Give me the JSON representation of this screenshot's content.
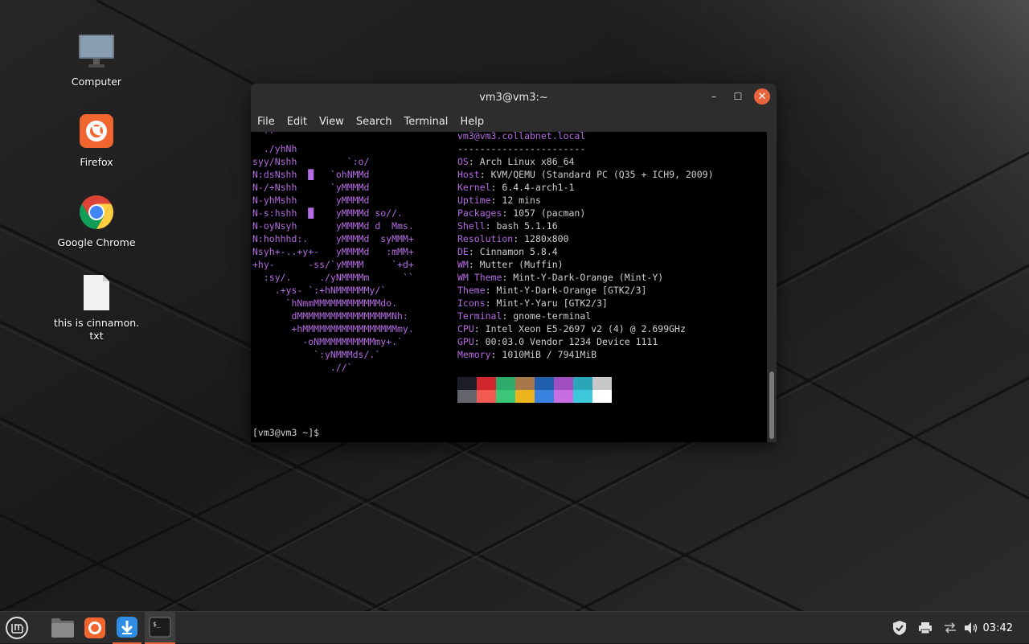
{
  "desktop": {
    "icons": [
      {
        "label": "Computer",
        "icon": "monitor-icon"
      },
      {
        "label": "Firefox",
        "icon": "firefox-icon"
      },
      {
        "label": "Google Chrome",
        "icon": "chrome-icon"
      },
      {
        "label": "this is cinnamon.\ntxt",
        "icon": "text-file-icon"
      }
    ]
  },
  "window": {
    "title": "vm3@vm3:~",
    "menu": [
      "File",
      "Edit",
      "View",
      "Search",
      "Terminal",
      "Help"
    ],
    "controls": {
      "minimize": "–",
      "maximize": "☐",
      "close": "✕"
    }
  },
  "terminal": {
    "ascii_lines": [
      "  ``",
      "  ./yhNh",
      "syy/Nshh         `:o/",
      "N:dsNshh  █   `ohNMMd",
      "N-/+Nshh      `yMMMMd",
      "N-yhMshh       yMMMMd",
      "N-s:hshh  █    yMMMMd so//.",
      "N-oyNsyh       yMMMMd d  Mms.",
      "N:hohhhd:.     yMMMMd  syMMM+",
      "Nsyh+-..+y+-   yMMMMd   :mMM+",
      "+hy-      -ss/`yMMMM     `+d+",
      "  :sy/.     ./yNMMMMm      ``",
      "    .+ys- `:+hNMMMMMMy/`",
      "      `hNmmMMMMMMMMMMMMdo.",
      "       dMMMMMMMMMMMMMMMMMNh:",
      "       +hMMMMMMMMMMMMMMMMMmy.",
      "         -oNMMMMMMMMMMmy+.`",
      "           `:yNMMMds/.`",
      "              .//`"
    ],
    "userhost": "vm3@vm3.collabnet.local",
    "separator": "-----------------------",
    "info": [
      {
        "key": "OS",
        "value": "Arch Linux x86_64"
      },
      {
        "key": "Host",
        "value": "KVM/QEMU (Standard PC (Q35 + ICH9, 2009)"
      },
      {
        "key": "Kernel",
        "value": "6.4.4-arch1-1"
      },
      {
        "key": "Uptime",
        "value": "12 mins"
      },
      {
        "key": "Packages",
        "value": "1057 (pacman)"
      },
      {
        "key": "Shell",
        "value": "bash 5.1.16"
      },
      {
        "key": "Resolution",
        "value": "1280x800"
      },
      {
        "key": "DE",
        "value": "Cinnamon 5.8.4"
      },
      {
        "key": "WM",
        "value": "Mutter (Muffin)"
      },
      {
        "key": "WM Theme",
        "value": "Mint-Y-Dark-Orange (Mint-Y)"
      },
      {
        "key": "Theme",
        "value": "Mint-Y-Dark-Orange [GTK2/3]"
      },
      {
        "key": "Icons",
        "value": "Mint-Y-Yaru [GTK2/3]"
      },
      {
        "key": "Terminal",
        "value": "gnome-terminal"
      },
      {
        "key": "CPU",
        "value": "Intel Xeon E5-2697 v2 (4) @ 2.699GHz"
      },
      {
        "key": "GPU",
        "value": "00:03.0 Vendor 1234 Device 1111"
      },
      {
        "key": "Memory",
        "value": "1010MiB / 7941MiB"
      }
    ],
    "palette_dark": [
      "#1e1e28",
      "#d0262c",
      "#2eaa6a",
      "#a9784a",
      "#1f5fae",
      "#a04fc0",
      "#2aa6b8",
      "#c8c8c8"
    ],
    "palette_bright": [
      "#64646c",
      "#f05a50",
      "#3cc878",
      "#ecb41c",
      "#3a82e0",
      "#c86ee0",
      "#3ec8dc",
      "#ffffff"
    ],
    "prompt": "[vm3@vm3 ~]$"
  },
  "panel": {
    "apps": [
      "menu-icon",
      "files-icon",
      "firefox-icon",
      "update-manager-icon",
      "terminal-icon"
    ],
    "tray": [
      "shield-icon",
      "printer-icon",
      "network-icon",
      "volume-icon"
    ],
    "clock": "03:42"
  }
}
